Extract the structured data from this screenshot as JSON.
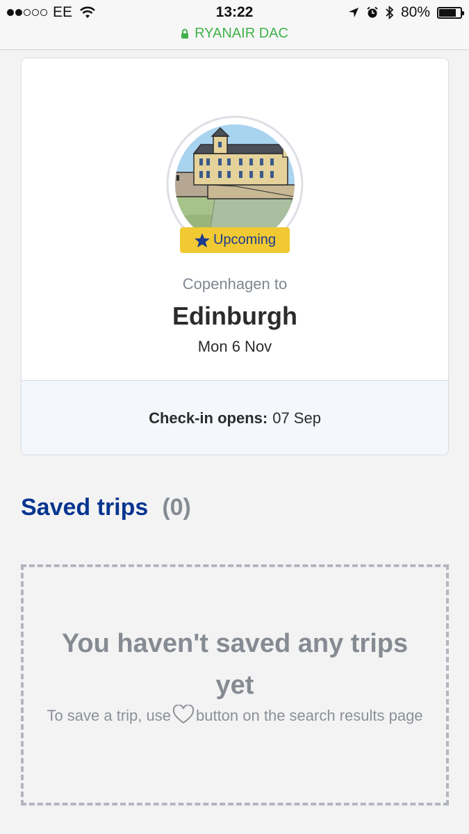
{
  "status_bar": {
    "carrier": "EE",
    "time": "13:22",
    "battery": "80%",
    "battery_level": 0.8,
    "site": "RYANAIR DAC"
  },
  "trip": {
    "badge": "Upcoming",
    "from_label": "Copenhagen to",
    "destination": "Edinburgh",
    "date": "Mon 6 Nov",
    "checkin_label": "Check-in opens:",
    "checkin_date": "07 Sep"
  },
  "saved": {
    "title": "Saved trips",
    "count": "(0)",
    "empty_title": "You haven't saved any trips yet",
    "hint_before": "To save a trip, use",
    "hint_after": "button on the search results page"
  },
  "colors": {
    "accent": "#073590",
    "badge": "#f1c933",
    "secure": "#3fb14a"
  }
}
